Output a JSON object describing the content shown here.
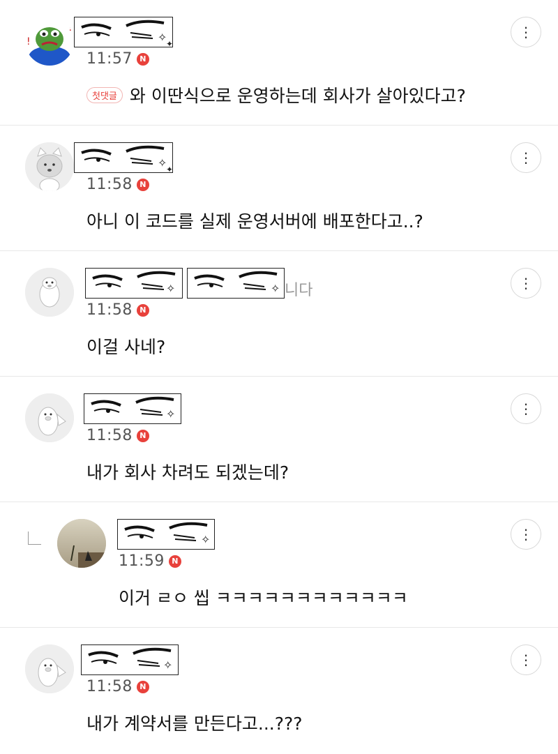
{
  "comments": [
    {
      "time": "11:57",
      "badge": "N",
      "first_badge": "첫댓글",
      "text": "와 이딴식으로 운영하는데 회사가 살아있다고?",
      "more": "⋮"
    },
    {
      "time": "11:58",
      "badge": "N",
      "text": "아니 이 코드를 실제 운영서버에 배포한다고..?",
      "more": "⋮"
    },
    {
      "time": "11:58",
      "badge": "N",
      "text": "이걸 사네?",
      "ghost_nick": "니다",
      "more": "⋮"
    },
    {
      "time": "11:58",
      "badge": "N",
      "text": "내가 회사 차려도 되겠는데?",
      "more": "⋮"
    },
    {
      "time": "11:59",
      "badge": "N",
      "text": "이거 ㄹㅇ 씹 ㅋㅋㅋㅋㅋㅋㅋㅋㅋㅋㅋㅋ",
      "more": "⋮",
      "is_reply": true
    },
    {
      "time": "11:58",
      "badge": "N",
      "text": "내가 계약서를 만든다고...???",
      "more": "⋮"
    }
  ],
  "colors": {
    "badge": "#e8413b",
    "divider": "#e8e8e8",
    "text": "#111111",
    "time": "#555555"
  },
  "icons": {
    "more": "more-vertical-icon",
    "reply": "reply-arrow-icon",
    "sparkle": "sparkle-icon"
  }
}
